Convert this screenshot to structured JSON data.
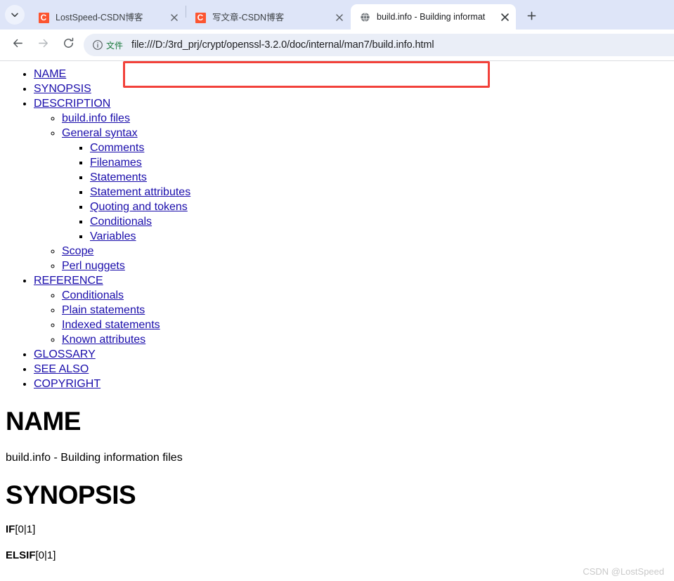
{
  "browser": {
    "tab_list_icon": "chevron-down-icon",
    "new_tab_label": "+",
    "tabs": [
      {
        "title": "LostSpeed-CSDN博客",
        "favicon": "csdn-favicon",
        "favicon_letter": "C",
        "active": false
      },
      {
        "title": "写文章-CSDN博客",
        "favicon": "csdn-favicon",
        "favicon_letter": "C",
        "active": false
      },
      {
        "title": "build.info - Building informat",
        "favicon": "globe-icon",
        "favicon_letter": "",
        "active": true
      }
    ],
    "toolbar": {
      "back_icon": "back-arrow-icon",
      "forward_icon": "forward-arrow-icon",
      "reload_icon": "reload-icon",
      "omnibox": {
        "info_icon": "info-circle-icon",
        "scheme_label": "文件",
        "url": "file:///D:/3rd_prj/crypt/openssl-3.2.0/doc/internal/man7/build.info.html"
      }
    },
    "annotation": {
      "shape": "rectangle",
      "color": "#f2413a"
    }
  },
  "page": {
    "toc": [
      {
        "label": "NAME",
        "level": 1
      },
      {
        "label": "SYNOPSIS",
        "level": 1
      },
      {
        "label": "DESCRIPTION",
        "level": 1
      },
      {
        "label": "build.info files",
        "level": 2
      },
      {
        "label": "General syntax",
        "level": 2
      },
      {
        "label": "Comments",
        "level": 3
      },
      {
        "label": "Filenames",
        "level": 3
      },
      {
        "label": "Statements",
        "level": 3
      },
      {
        "label": "Statement attributes",
        "level": 3
      },
      {
        "label": "Quoting and tokens",
        "level": 3
      },
      {
        "label": "Conditionals",
        "level": 3
      },
      {
        "label": "Variables",
        "level": 3
      },
      {
        "label": "Scope",
        "level": 2
      },
      {
        "label": "Perl nuggets",
        "level": 2
      },
      {
        "label": "REFERENCE",
        "level": 1
      },
      {
        "label": "Conditionals",
        "level": 2
      },
      {
        "label": "Plain statements",
        "level": 2
      },
      {
        "label": "Indexed statements",
        "level": 2
      },
      {
        "label": "Known attributes",
        "level": 2
      },
      {
        "label": "GLOSSARY",
        "level": 1
      },
      {
        "label": "SEE ALSO",
        "level": 1
      },
      {
        "label": "COPYRIGHT",
        "level": 1
      }
    ],
    "sections": {
      "name_heading": "NAME",
      "name_body": "build.info - Building information files",
      "synopsis_heading": "SYNOPSIS",
      "synopsis_line1_bold": "IF",
      "synopsis_line1_rest": "[0|1]",
      "synopsis_line2_bold": "ELSIF",
      "synopsis_line2_rest": "[0|1]"
    },
    "watermark": "CSDN @LostSpeed"
  }
}
